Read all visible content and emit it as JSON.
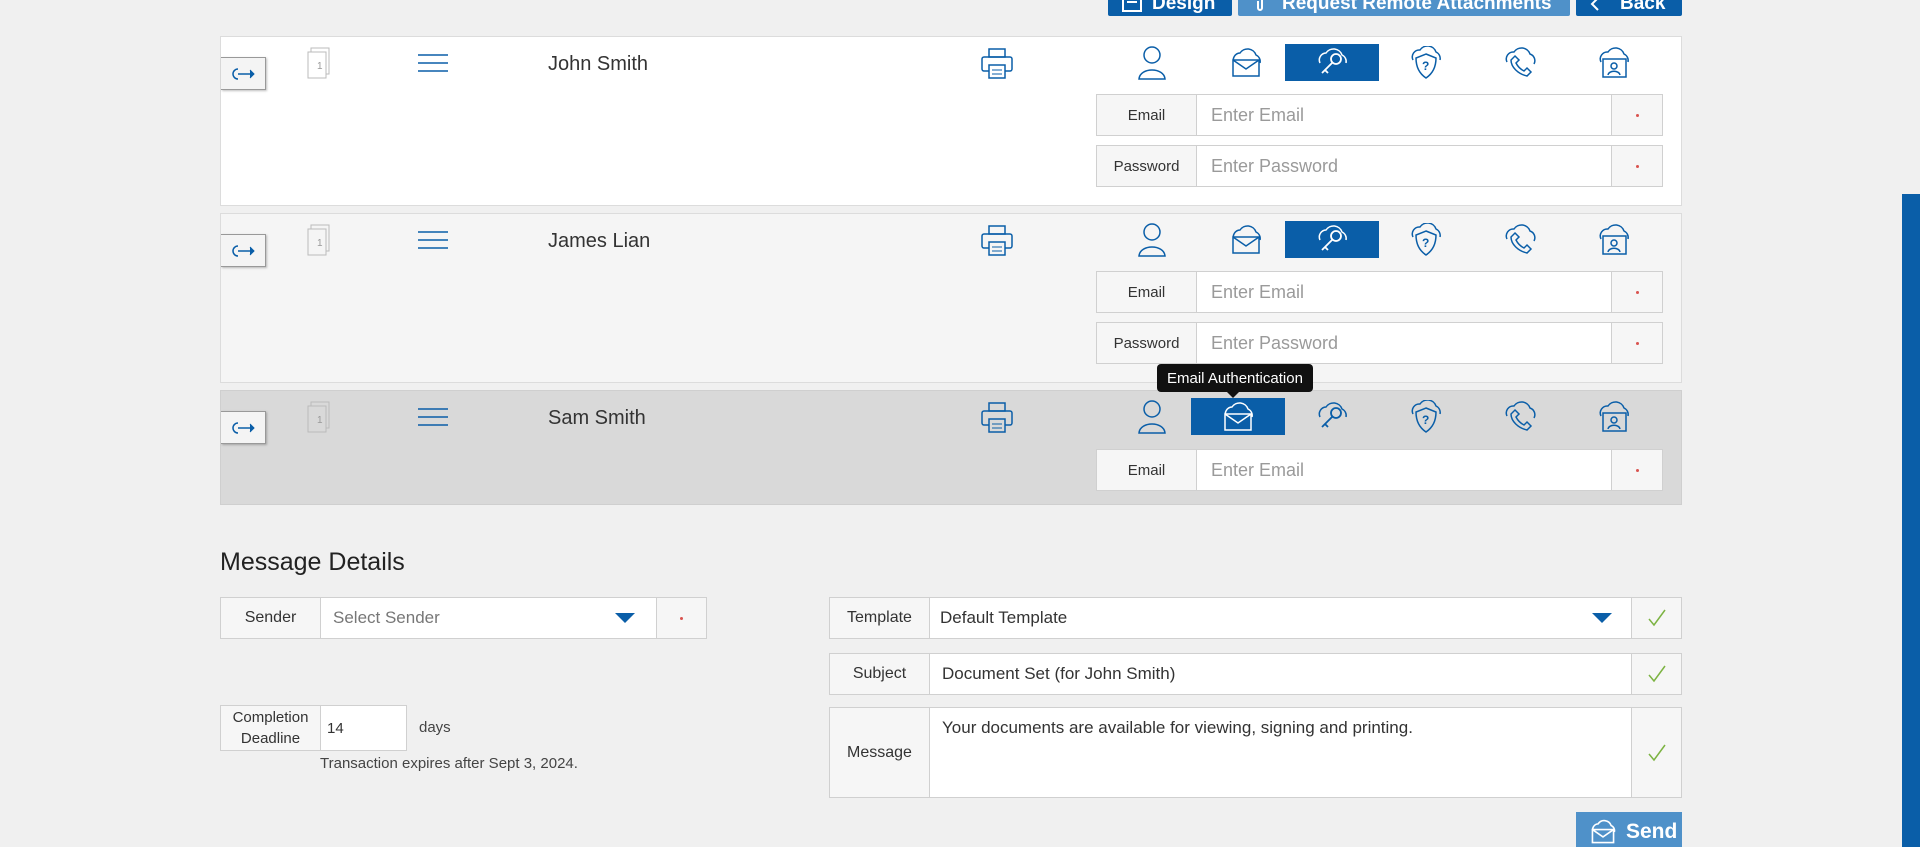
{
  "toolbar": {
    "design_label": "Design",
    "request_label": "Request Remote Attachments",
    "back_label": "Back"
  },
  "signers": [
    {
      "name": "John Smith",
      "email_label": "Email",
      "email_placeholder": "Enter Email",
      "password_label": "Password",
      "password_placeholder": "Enter Password"
    },
    {
      "name": "James Lian",
      "email_label": "Email",
      "email_placeholder": "Enter Email",
      "password_label": "Password",
      "password_placeholder": "Enter Password"
    },
    {
      "name": "Sam Smith",
      "email_label": "Email",
      "email_placeholder": "Enter Email"
    }
  ],
  "doc_count": "1",
  "tooltip": "Email Authentication",
  "message_details": {
    "title": "Message Details",
    "sender_label": "Sender",
    "sender_placeholder": "Select Sender",
    "template_label": "Template",
    "template_value": "Default Template",
    "subject_label": "Subject",
    "subject_value": "Document Set (for John Smith)",
    "message_label": "Message",
    "message_value": "Your documents are available for viewing, signing and printing.",
    "deadline_label_1": "Completion",
    "deadline_label_2": "Deadline",
    "deadline_value": "14",
    "deadline_unit": "days",
    "expiry_note": "Transaction expires after Sept 3, 2024."
  },
  "send_label": "Send",
  "colors": {
    "primary": "#0a5ea8",
    "send": "#4f91c9",
    "active_row": "#d9d9d9"
  }
}
